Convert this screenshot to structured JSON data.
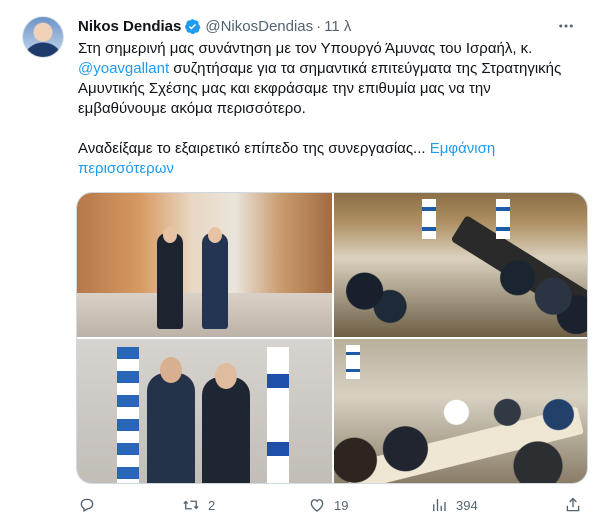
{
  "tweet": {
    "author_name": "Nikos Dendias",
    "handle": "@NikosDendias",
    "separator": "·",
    "time": "11 λ",
    "text_part1": "Στη σημερινή μας συνάντηση με τον Υπουργό Άμυνας του Ισραήλ, κ.",
    "mention": "@yoavgallant",
    "text_part2": " συζητήσαμε για τα σημαντικά επιτεύγματα της Στρατηγικής Αμυντικής Σχέσης μας και εκφράσαμε την επιθυμία μας να την εμβαθύνουμε ακόμα περισσότερο.",
    "paragraph2": "Αναδείξαμε το εξαιρετικό επίπεδο της συνεργασίας...",
    "show_more": "Εμφάνιση περισσότερων"
  },
  "stats": {
    "replies": "",
    "retweets": "2",
    "likes": "19",
    "views": "394"
  },
  "colors": {
    "accent": "#1d9bf0",
    "text": "#0f1419",
    "muted": "#536471",
    "border": "#cfd9de"
  },
  "icons": [
    "more-icon",
    "verified-icon",
    "reply-icon",
    "retweet-icon",
    "like-icon",
    "views-icon",
    "share-icon"
  ]
}
